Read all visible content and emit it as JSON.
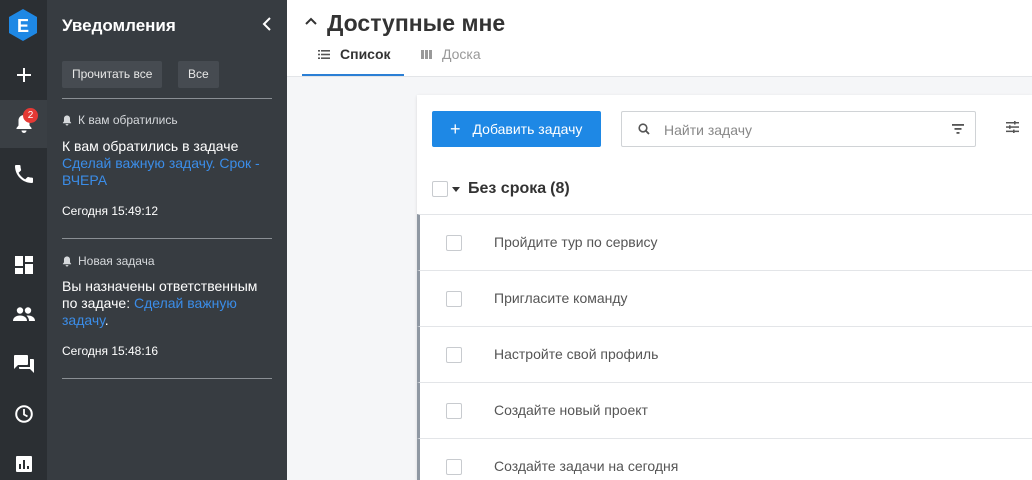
{
  "rail": {
    "logo": "E",
    "notification_badge": "2",
    "items": [
      "add-icon",
      "bell-icon",
      "phone-icon",
      "dashboard-icon",
      "team-icon",
      "chat-icon",
      "clock-icon",
      "reports-icon"
    ]
  },
  "panel": {
    "title": "Уведомления",
    "read_all": "Прочитать все",
    "all": "Все",
    "notifications": [
      {
        "head": "К вам обратились",
        "body_prefix": "К вам обратились в задаче ",
        "link": "Сделай важную задачу. Срок - ВЧЕРА",
        "body_suffix": "",
        "time": "Сегодня 15:49:12"
      },
      {
        "head": "Новая задача",
        "body_prefix": "Вы назначены ответственным по задаче: ",
        "link": "Сделай важную задачу",
        "body_suffix": ".",
        "time": "Сегодня 15:48:16"
      }
    ]
  },
  "header": {
    "title": "Доступные мне",
    "tabs": [
      {
        "label": "Список",
        "active": true
      },
      {
        "label": "Доска",
        "active": false
      }
    ]
  },
  "toolbar": {
    "add_label": "Добавить задачу",
    "search_placeholder": "Найти задачу"
  },
  "group": {
    "title": "Без срока",
    "count": "(8)"
  },
  "tasks": [
    "Пройдите тур по сервису",
    "Пригласите команду",
    "Настройте свой профиль",
    "Создайте новый проект",
    "Создайте задачи на сегодня"
  ],
  "colors": {
    "accent": "#1e88e5",
    "link": "#3b8de8",
    "rail_bg": "#2b2f33",
    "panel_bg": "#373c41",
    "badge": "#e53935"
  }
}
